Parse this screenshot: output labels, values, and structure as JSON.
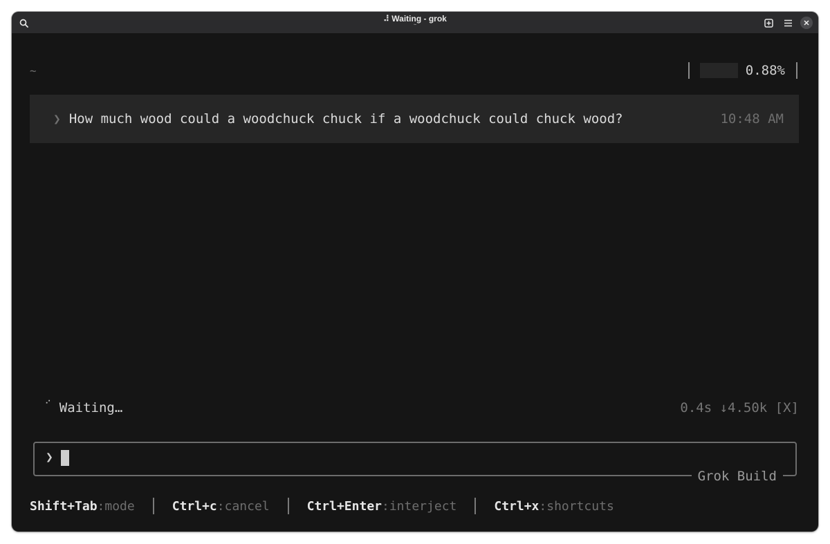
{
  "window": {
    "title": "Waiting - grok",
    "title_icon": "⠼",
    "subtitle": "~"
  },
  "toolbar": {
    "search_icon": "search-icon",
    "new_tab_icon": "new-tab-icon",
    "menu_icon": "hamburger-menu-icon",
    "close_icon": "close-icon"
  },
  "terminal": {
    "cwd": "~",
    "context_usage": "0.88%",
    "context_usage_value": 0.0088,
    "messages": [
      {
        "chevron": "❯",
        "text": "How much wood could a woodchuck chuck if a woodchuck could chuck wood?",
        "time": "10:48 AM"
      }
    ],
    "status": {
      "spinner": "⠊",
      "text": "Waiting…",
      "stats": "0.4s ↓4.50k [X]"
    },
    "input": {
      "chevron": "❯",
      "value": "",
      "label": "Grok Build"
    },
    "hints": [
      {
        "key": "Shift+Tab",
        "action": ":mode"
      },
      {
        "key": "Ctrl+c",
        "action": ":cancel"
      },
      {
        "key": "Ctrl+Enter",
        "action": ":interject"
      },
      {
        "key": "Ctrl+x",
        "action": ":shortcuts"
      }
    ]
  },
  "colors": {
    "background": "#151515",
    "titlebar": "#2b2b2d",
    "message_bg": "#262626",
    "text": "#d6d6d6",
    "dim_text": "#6e6e6e"
  }
}
